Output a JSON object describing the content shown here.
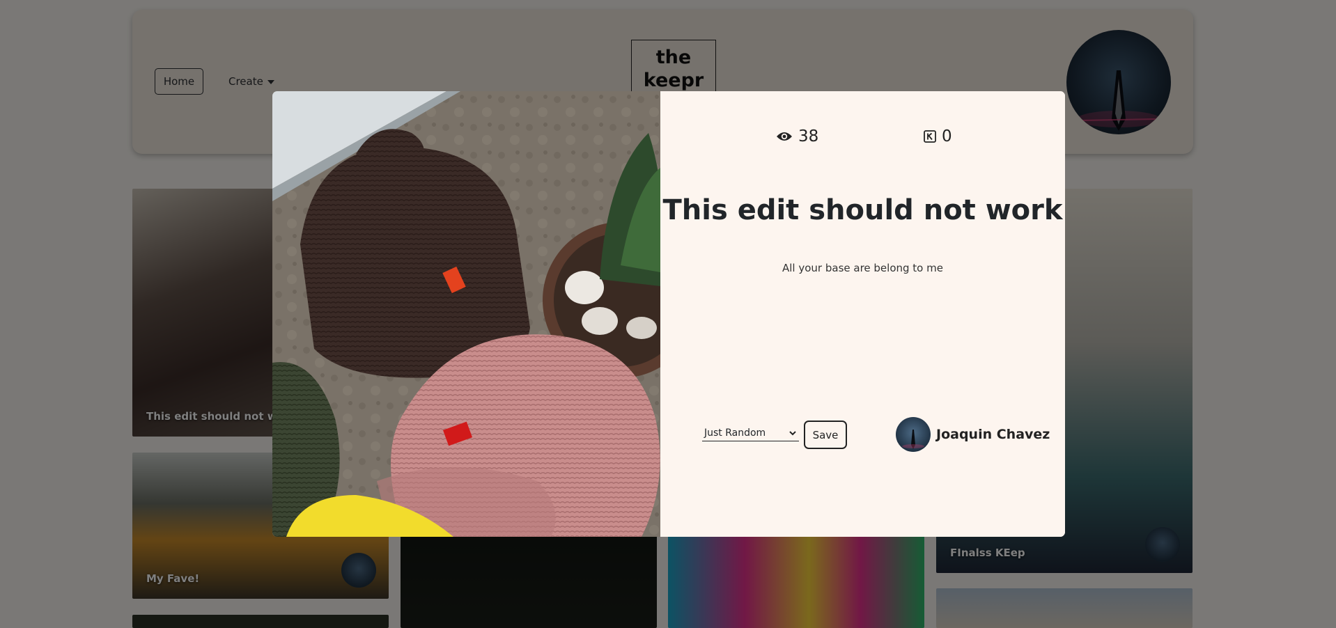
{
  "nav": {
    "home_label": "Home",
    "create_label": "Create",
    "logo_text": "the\nkeepr"
  },
  "cards": [
    {
      "title": "This edit should not work"
    },
    {
      "title": "My Fave!"
    },
    {
      "title": "FInalss KEep"
    }
  ],
  "modal": {
    "views": "38",
    "keeps": "0",
    "title": "This edit should not work",
    "description": "All your base are belong to me",
    "vault_select": {
      "selected": "Just Random"
    },
    "save_label": "Save",
    "creator_name": "Joaquin Chavez"
  },
  "icons": {
    "views": "eye-icon",
    "keeps": "keep-k-icon",
    "select": "chevron-down-icon"
  }
}
